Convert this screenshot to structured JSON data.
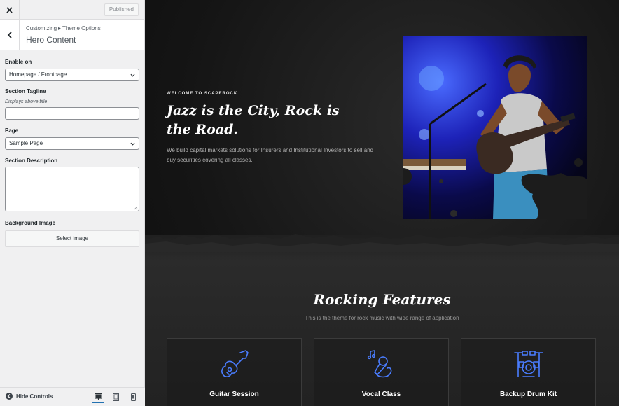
{
  "sidebar": {
    "close_icon": "close-icon",
    "status": "Published",
    "breadcrumb": {
      "root": "Customizing",
      "separator": "▸",
      "section": "Theme Options"
    },
    "panel_title": "Hero Content",
    "controls": {
      "enable_on": {
        "label": "Enable on",
        "value": "Homepage / Frontpage"
      },
      "tagline": {
        "label": "Section Tagline",
        "description": "Displays above title",
        "value": ""
      },
      "page": {
        "label": "Page",
        "value": "Sample Page"
      },
      "description": {
        "label": "Section Description",
        "value": ""
      },
      "background": {
        "label": "Background Image",
        "button": "Select image"
      }
    },
    "footer": {
      "hide_controls": "Hide Controls",
      "devices": [
        "desktop",
        "tablet",
        "mobile"
      ],
      "active_device": "desktop"
    }
  },
  "preview": {
    "hero": {
      "tagline": "WELCOME TO SCAPEROCK",
      "title": "Jazz is the City, Rock is the Road.",
      "description": "We build capital markets solutions for Insurers and Institutional Investors to sell and buy securities covering all classes."
    },
    "features": {
      "title": "Rocking Features",
      "subtitle": "This is the theme for rock music with wide range of application",
      "items": [
        {
          "label": "Guitar Session",
          "icon": "guitar-icon"
        },
        {
          "label": "Vocal Class",
          "icon": "microphone-icon"
        },
        {
          "label": "Backup Drum Kit",
          "icon": "drum-kit-icon"
        }
      ]
    },
    "colors": {
      "accent": "#4a7dff",
      "background": "#141414"
    }
  }
}
